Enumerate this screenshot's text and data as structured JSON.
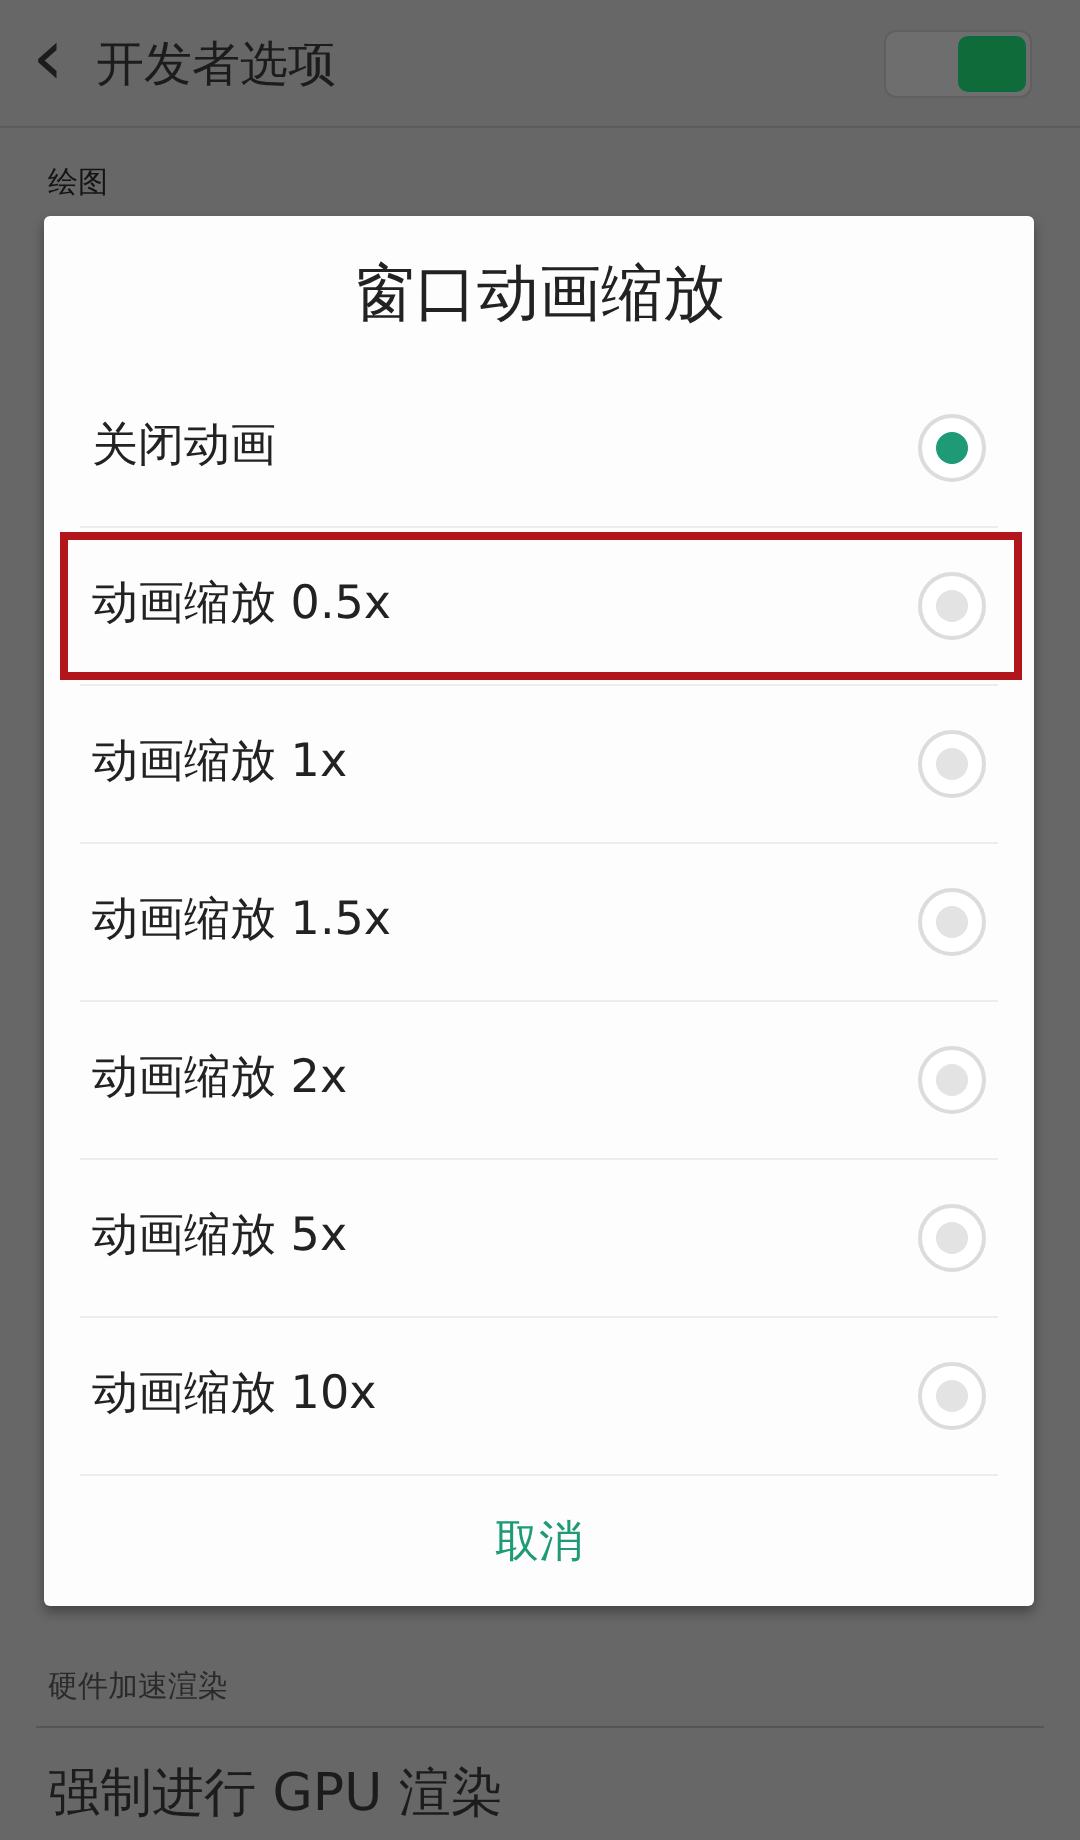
{
  "header": {
    "back_icon": "‹",
    "title": "开发者选项",
    "switch": {
      "on": true
    }
  },
  "sections": [
    {
      "label": "绘图"
    },
    {
      "label": "硬件加速渲染"
    }
  ],
  "setting_row": {
    "title": "强制进行 GPU 渲染"
  },
  "dialog": {
    "title": "窗口动画缩放",
    "options": [
      {
        "label": "关闭动画",
        "selected": true,
        "highlighted": false
      },
      {
        "label": "动画缩放 0.5x",
        "selected": false,
        "highlighted": true
      },
      {
        "label": "动画缩放 1x",
        "selected": false,
        "highlighted": false
      },
      {
        "label": "动画缩放 1.5x",
        "selected": false,
        "highlighted": false
      },
      {
        "label": "动画缩放 2x",
        "selected": false,
        "highlighted": false
      },
      {
        "label": "动画缩放 5x",
        "selected": false,
        "highlighted": false
      },
      {
        "label": "动画缩放 10x",
        "selected": false,
        "highlighted": false
      }
    ],
    "cancel": "取消"
  }
}
